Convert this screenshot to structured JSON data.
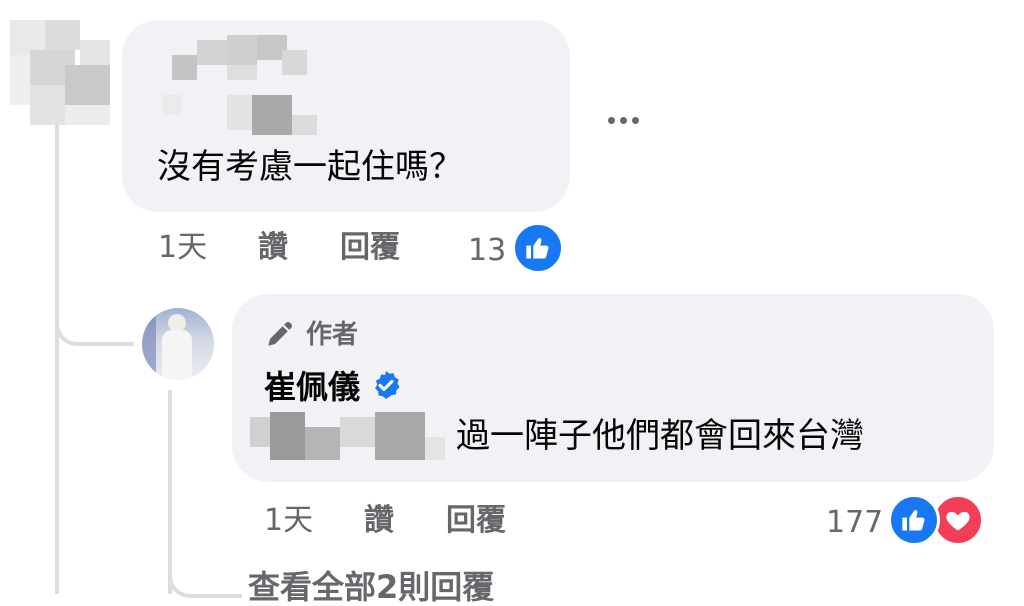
{
  "comment": {
    "text": "沒有考慮一起住嗎？",
    "time": "1天",
    "like_label": "讚",
    "reply_label": "回覆",
    "reaction_count": "13",
    "more_label": "•••"
  },
  "reply": {
    "author_badge": "作者",
    "author_name": "崔佩儀",
    "text": "過一陣子他們都會回來台灣",
    "time": "1天",
    "like_label": "讚",
    "reply_label": "回覆",
    "reaction_count": "177"
  },
  "view_more": "查看全部2則回覆",
  "colors": {
    "bubble_bg": "#f0f2f5",
    "like_blue": "#1877f2",
    "love_red": "#f33e58",
    "verified_blue": "#1877f2",
    "meta_gray": "#65676b"
  },
  "icons": [
    "like-reaction-icon",
    "love-reaction-icon",
    "verified-badge-icon",
    "author-pen-icon",
    "more-options-icon"
  ]
}
